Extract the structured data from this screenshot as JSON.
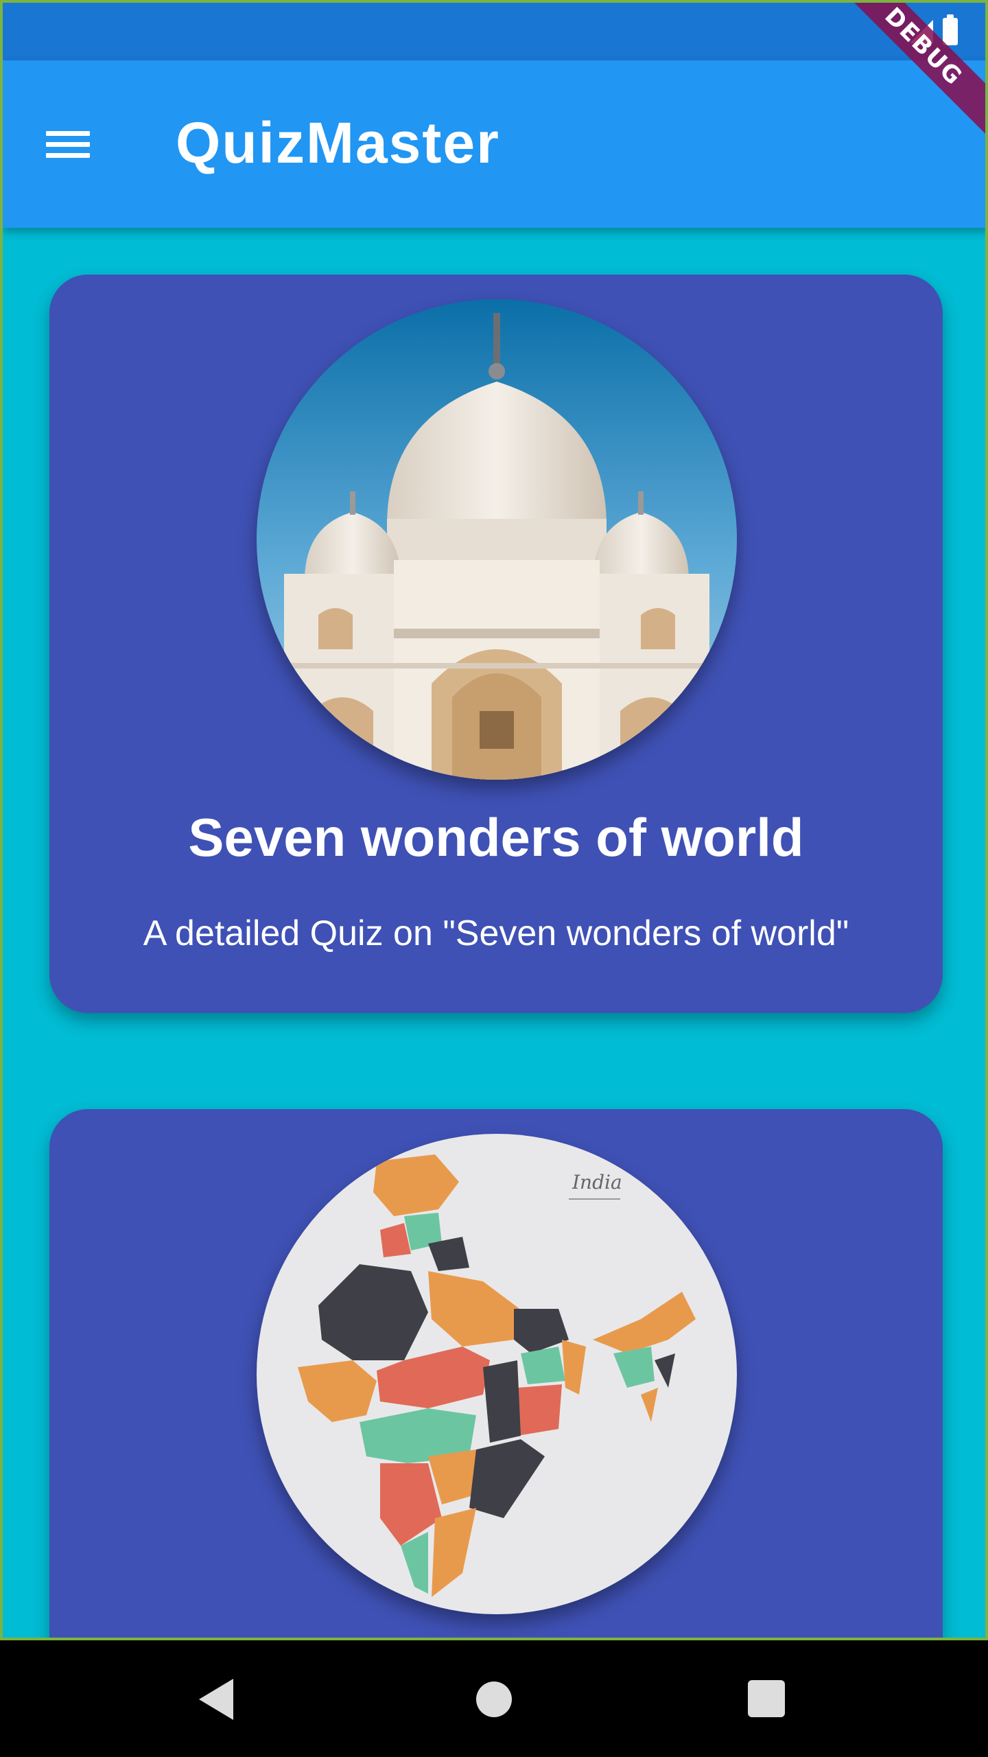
{
  "status_bar": {
    "icons": [
      "signal-icon",
      "battery-icon"
    ]
  },
  "app_bar": {
    "title": "QuizMaster",
    "menu_icon": "menu-icon",
    "debug_label": "DEBUG"
  },
  "quizzes": [
    {
      "title": "Seven wonders of world",
      "subtitle": "A detailed Quiz on \"Seven wonders of world\"",
      "image": "taj-mahal-photo"
    },
    {
      "title": "",
      "subtitle": "",
      "image": "india-map",
      "image_caption": "India"
    }
  ],
  "nav_bar": {
    "buttons": [
      "back-icon",
      "home-icon",
      "recent-apps-icon"
    ]
  },
  "colors": {
    "background": "#00BCD4",
    "app_bar": "#2196F3",
    "status_bar": "#1976D2",
    "card": "#3F51B5",
    "debug_banner": "#880E4F"
  }
}
